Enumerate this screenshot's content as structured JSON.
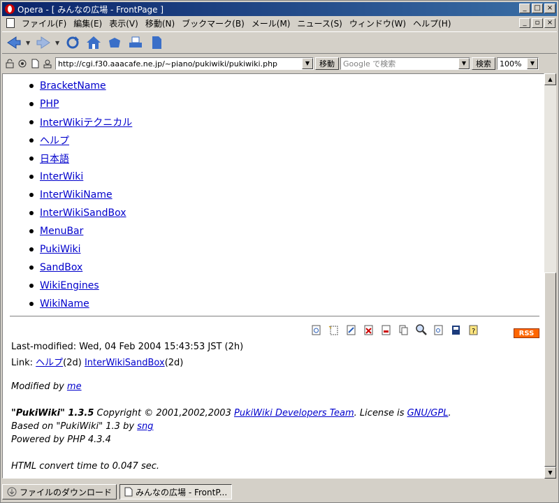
{
  "window": {
    "title": "Opera - [ みんなの広場 - FrontPage ]",
    "minimize": "_",
    "maximize": "□",
    "close": "×",
    "mdi_restore": "▫"
  },
  "menu": {
    "items": [
      "ファイル(F)",
      "編集(E)",
      "表示(V)",
      "移動(N)",
      "ブックマーク(B)",
      "メール(M)",
      "ニュース(S)",
      "ウィンドウ(W)",
      "ヘルプ(H)"
    ]
  },
  "address": {
    "url": "http://cgi.f30.aaacafe.ne.jp/~piano/pukiwiki/pukiwiki.php",
    "go_label": "移動",
    "search_placeholder": "Google で検索",
    "search_label": "検索",
    "zoom": "100%"
  },
  "pages": [
    "BracketName",
    "PHP",
    "InterWikiテクニカル",
    "ヘルプ",
    "日本語",
    "InterWiki",
    "InterWikiName",
    "InterWikiSandBox",
    "MenuBar",
    "PukiWiki",
    "SandBox",
    "WikiEngines",
    "WikiName"
  ],
  "footer": {
    "rss": "RSS",
    "last_modified": "Last-modified: Wed, 04 Feb 2004 15:43:53 JST (2h)",
    "link_prefix": "Link: ",
    "link1": "ヘルプ",
    "link1_age": "(2d) ",
    "link2": "InterWikiSandBox",
    "link2_age": "(2d)",
    "modified_by": "Modified by ",
    "modified_by_link": "me",
    "copyright_name": "\"PukiWiki\" 1.3.5",
    "copyright_text": " Copyright © 2001,2002,2003 ",
    "copyright_link": "PukiWiki Developers Team",
    "license_text": ". License is ",
    "license_link": "GNU/GPL",
    "license_end": ".",
    "based_on": "Based on \"PukiWiki\" 1.3 by ",
    "based_on_link": "sng",
    "powered_by": "Powered by PHP 4.3.4",
    "convert_time": "HTML convert time to 0.047 sec."
  },
  "tabs": [
    {
      "label": "ファイルのダウンロード"
    },
    {
      "label": "みんなの広場 - FrontP..."
    }
  ]
}
